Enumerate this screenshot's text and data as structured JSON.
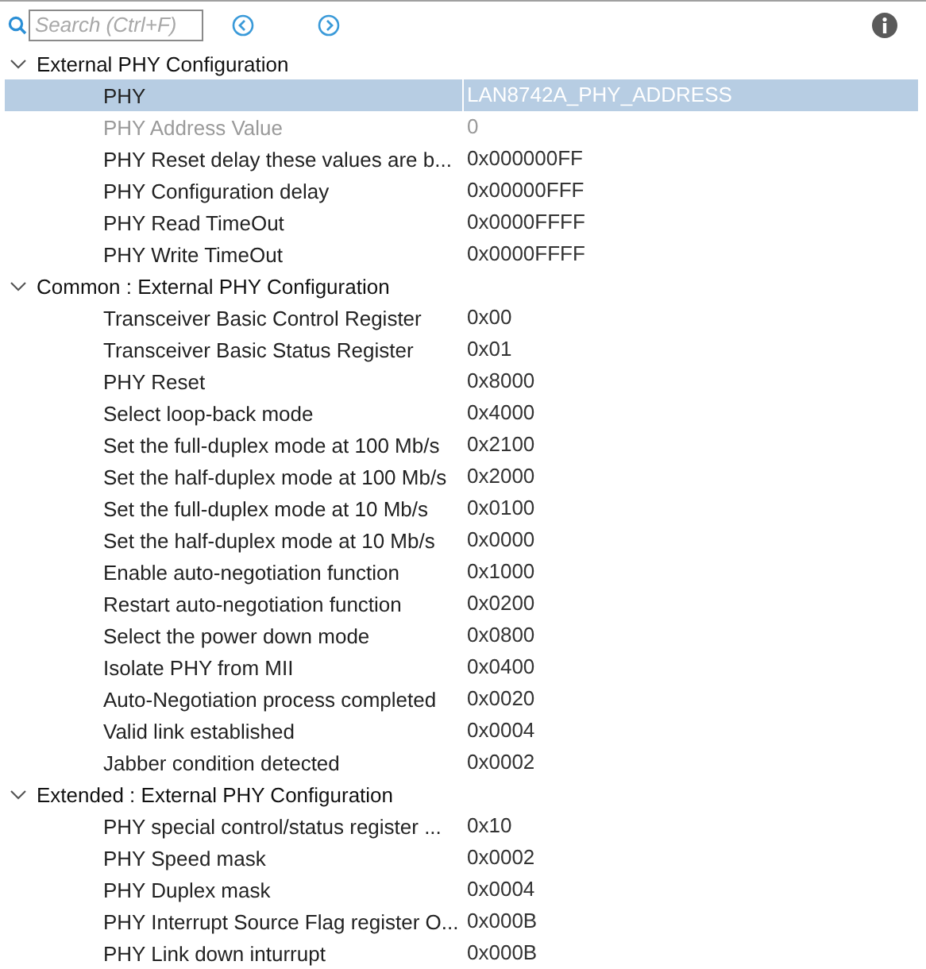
{
  "search": {
    "placeholder": "Search (Ctrl+F)"
  },
  "groups": [
    {
      "title": "External PHY Configuration",
      "expanded": true,
      "rows": [
        {
          "label": "PHY",
          "value": "LAN8742A_PHY_ADDRESS",
          "selected": true,
          "disabled": false
        },
        {
          "label": "PHY Address Value",
          "value": "0",
          "selected": false,
          "disabled": true
        },
        {
          "label": "PHY Reset delay these values are b...",
          "value": "0x000000FF",
          "selected": false,
          "disabled": false
        },
        {
          "label": "PHY Configuration delay",
          "value": "0x00000FFF",
          "selected": false,
          "disabled": false
        },
        {
          "label": "PHY Read TimeOut",
          "value": "0x0000FFFF",
          "selected": false,
          "disabled": false
        },
        {
          "label": "PHY Write TimeOut",
          "value": "0x0000FFFF",
          "selected": false,
          "disabled": false
        }
      ]
    },
    {
      "title": "Common : External PHY Configuration",
      "expanded": true,
      "rows": [
        {
          "label": "Transceiver Basic Control Register",
          "value": "0x00",
          "selected": false,
          "disabled": false
        },
        {
          "label": "Transceiver Basic Status Register",
          "value": "0x01",
          "selected": false,
          "disabled": false
        },
        {
          "label": "PHY Reset",
          "value": "0x8000",
          "selected": false,
          "disabled": false
        },
        {
          "label": "Select loop-back mode",
          "value": "0x4000",
          "selected": false,
          "disabled": false
        },
        {
          "label": "Set the full-duplex mode at 100 Mb/s",
          "value": "0x2100",
          "selected": false,
          "disabled": false
        },
        {
          "label": "Set the half-duplex mode at 100 Mb/s",
          "value": "0x2000",
          "selected": false,
          "disabled": false
        },
        {
          "label": "Set the full-duplex mode at 10 Mb/s",
          "value": "0x0100",
          "selected": false,
          "disabled": false
        },
        {
          "label": "Set the half-duplex mode at 10 Mb/s",
          "value": "0x0000",
          "selected": false,
          "disabled": false
        },
        {
          "label": "Enable auto-negotiation function",
          "value": "0x1000",
          "selected": false,
          "disabled": false
        },
        {
          "label": "Restart auto-negotiation function",
          "value": "0x0200",
          "selected": false,
          "disabled": false
        },
        {
          "label": "Select the power down mode",
          "value": "0x0800",
          "selected": false,
          "disabled": false
        },
        {
          "label": "Isolate PHY from MII",
          "value": "0x0400",
          "selected": false,
          "disabled": false
        },
        {
          "label": "Auto-Negotiation process completed",
          "value": "0x0020",
          "selected": false,
          "disabled": false
        },
        {
          "label": "Valid link established",
          "value": "0x0004",
          "selected": false,
          "disabled": false
        },
        {
          "label": "Jabber condition detected",
          "value": "0x0002",
          "selected": false,
          "disabled": false
        }
      ]
    },
    {
      "title": "Extended : External PHY Configuration",
      "expanded": true,
      "rows": [
        {
          "label": "PHY special control/status register ...",
          "value": "0x10",
          "selected": false,
          "disabled": false
        },
        {
          "label": "PHY Speed mask",
          "value": "0x0002",
          "selected": false,
          "disabled": false
        },
        {
          "label": "PHY Duplex mask",
          "value": "0x0004",
          "selected": false,
          "disabled": false
        },
        {
          "label": "PHY Interrupt Source Flag register O...",
          "value": "0x000B",
          "selected": false,
          "disabled": false
        },
        {
          "label": "PHY Link down inturrupt",
          "value": "0x000B",
          "selected": false,
          "disabled": false
        }
      ]
    }
  ]
}
